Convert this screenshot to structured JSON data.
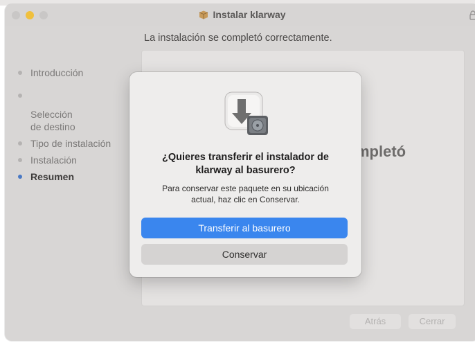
{
  "window": {
    "title": "Instalar klarway"
  },
  "main": {
    "status_text": "La instalación se completó correctamente.",
    "big_text_fragment": "mpletó",
    "big_dot": "."
  },
  "sidebar": {
    "steps": [
      {
        "label": "Introducción"
      },
      {
        "label": "Selección\nde destino"
      },
      {
        "label": "Tipo de instalación"
      },
      {
        "label": "Instalación"
      },
      {
        "label": "Resumen"
      }
    ]
  },
  "footer": {
    "back_label": "Atrás",
    "close_label": "Cerrar"
  },
  "dialog": {
    "icon": "installer-drive-icon",
    "title": "¿Quieres transferir el instalador de klarway al basurero?",
    "message": "Para conservar este paquete en su ubicación actual, haz clic en Conservar.",
    "primary_label": "Transferir al basurero",
    "secondary_label": "Conservar"
  },
  "colors": {
    "accent": "#3a86ee",
    "active_step_dot": "#4a79c4",
    "minimize_button": "#f0c03d"
  }
}
